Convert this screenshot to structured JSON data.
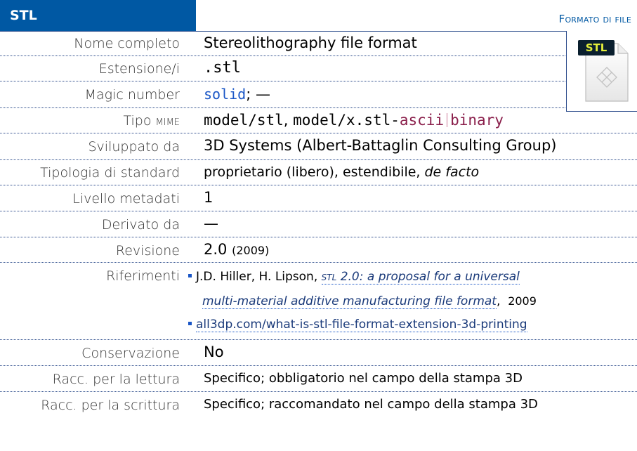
{
  "header": {
    "title": "STL",
    "category": "Formato di file"
  },
  "icon": {
    "name": "stl-file-icon",
    "badge": "STL"
  },
  "rows": {
    "nome_completo": {
      "label": "Nome completo",
      "value": "Stereolithography file format"
    },
    "estensione": {
      "label": "Estensione/i",
      "value": ".stl"
    },
    "magic": {
      "label": "Magic number",
      "value": "solid",
      "suffix": "; —"
    },
    "mime": {
      "label_a": "Tipo ",
      "label_b": "MIME",
      "value_a": "model/stl",
      "sep": ", ",
      "value_b": "model/x.stl-",
      "value_c": "ascii",
      "value_d": "binary"
    },
    "sviluppato": {
      "label": "Sviluppato da",
      "value": "3D Systems (Albert-Battaglin Consulting Group)"
    },
    "tipologia": {
      "label": "Tipologia di standard",
      "value": "proprietario (libero), estendibile, ",
      "value_ital": "de facto"
    },
    "livello": {
      "label": "Livello metadati",
      "value": "1"
    },
    "derivato": {
      "label": "Derivato da",
      "value": "—"
    },
    "revisione": {
      "label": "Revisione",
      "value": "2.0",
      "year": "(2009)"
    },
    "riferimenti": {
      "label": "Riferimenti",
      "ref1_authors": "J.D. Hiller, H. Lipson, ",
      "ref1_title_sc": "STL",
      "ref1_title_a": " 2.0: a proposal for a universal",
      "ref1_title_b": "multi-material additive manufacturing file format",
      "ref1_year": "2009",
      "ref2": "all3dp.com/what-is-stl-file-format-extension-3d-printing"
    },
    "conservazione": {
      "label": "Conservazione",
      "value": "No"
    },
    "lettura": {
      "label": "Racc. per la lettura",
      "value": "Specifico; obbligatorio nel campo della stampa ",
      "tail": "3D"
    },
    "scrittura": {
      "label": "Racc. per la scrittura",
      "value": "Specifico; raccomandato nel campo della stampa ",
      "tail": "3D"
    }
  },
  "colors": {
    "header_bg": "#0058a3",
    "accent": "#1a56c6",
    "maroon": "#8a1f4b",
    "badge_bg": "#0a1f2e",
    "badge_text": "#e3ee3a"
  }
}
